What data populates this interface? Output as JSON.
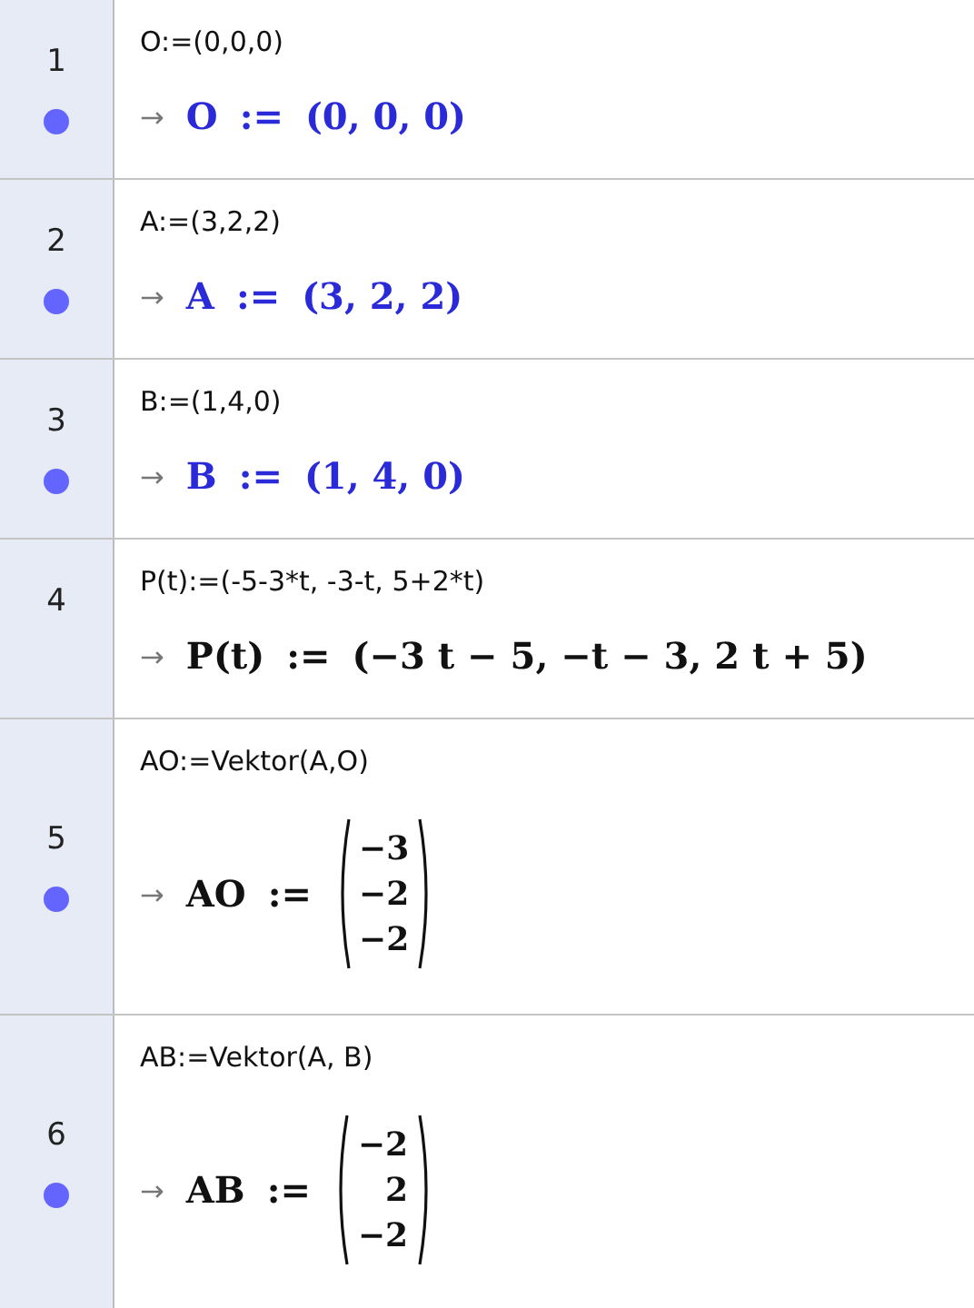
{
  "rows": [
    {
      "number": "1",
      "visible": true,
      "input": "O:=(0,0,0)",
      "arrow": "→",
      "output": {
        "kind": "tuple",
        "color": "#2a2ad8",
        "name": "O",
        "assign": ":=",
        "value": "(0, 0, 0)"
      }
    },
    {
      "number": "2",
      "visible": true,
      "input": "A:=(3,2,2)",
      "arrow": "→",
      "output": {
        "kind": "tuple",
        "color": "#2a2ad8",
        "name": "A",
        "assign": ":=",
        "value": "(3, 2, 2)"
      }
    },
    {
      "number": "3",
      "visible": true,
      "input": "B:=(1,4,0)",
      "arrow": "→",
      "output": {
        "kind": "tuple",
        "color": "#2a2ad8",
        "name": "B",
        "assign": ":=",
        "value": "(1, 4, 0)"
      }
    },
    {
      "number": "4",
      "visible": false,
      "input": "P(t):=(-5-3*t, -3-t, 5+2*t)",
      "arrow": "→",
      "output": {
        "kind": "tuple",
        "color": "#111111",
        "name": "P(t)",
        "assign": ":=",
        "value": "(−3 t − 5, −t − 3, 2 t + 5)"
      }
    },
    {
      "number": "5",
      "visible": true,
      "input": "AO:=Vektor(A,O)",
      "arrow": "→",
      "output": {
        "kind": "vector",
        "color": "#111111",
        "name": "AO",
        "assign": ":=",
        "components": [
          "−3",
          "−2",
          "−2"
        ]
      }
    },
    {
      "number": "6",
      "visible": true,
      "input": "AB:=Vektor(A, B)",
      "arrow": "→",
      "output": {
        "kind": "vector",
        "color": "#111111",
        "name": "AB",
        "assign": ":=",
        "components": [
          "−2",
          "2",
          "−2"
        ]
      }
    }
  ]
}
